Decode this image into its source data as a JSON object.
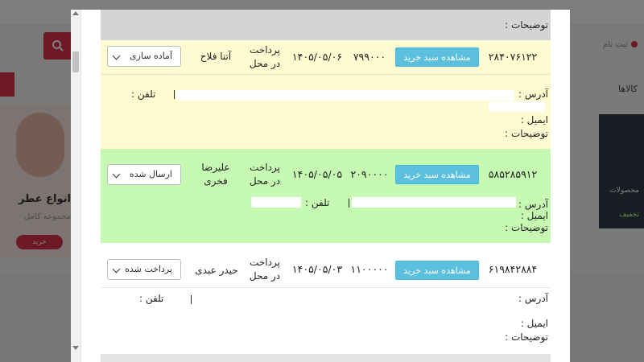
{
  "background": {
    "bg_promo_title": "انواع عطر",
    "bg_promo_sub": "مجموعه کامل",
    "bg_promo_btn": "خرید",
    "bg_user": "ثبت نام",
    "bg_category": "کالاها",
    "bg_card_1": "محصولات",
    "bg_card_2": "تخفیف"
  },
  "modal": {
    "top_notes_label": "توضیحات :",
    "orders": [
      {
        "code": "۲۸۴۰۷۶۱۲۲",
        "basket_label": "مشاهده سبد خرید",
        "amount": "۷۹۹۰۰۰",
        "date": "۱۴۰۵/۰۵/۰۶",
        "payment_line1": "پرداخت",
        "payment_line2": "در محل",
        "customer_line1": "آتنا فلاح",
        "customer_line2": "",
        "status": "آماده سازی",
        "address_label": "آدرس :",
        "phone_label": "تلفن :",
        "email_label": "ایمیل :",
        "notes_label": "توضیحات :"
      },
      {
        "code": "۵۸۵۲۸۵۹۱۲",
        "basket_label": "مشاهده سبد خرید",
        "amount": "۲۰۹۰۰۰۰",
        "date": "۱۴۰۵/۰۵/۰۵",
        "payment_line1": "پرداخت",
        "payment_line2": "در محل",
        "customer_line1": "علیرضا",
        "customer_line2": "فخری",
        "status": "ارسال شده",
        "address_label": "آدرس :",
        "phone_label": "تلفن :",
        "email_label": "ایمیل :",
        "notes_label": "توضیحات :"
      },
      {
        "code": "۶۱۹۸۴۲۸۸۴",
        "basket_label": "مشاهده سبد خرید",
        "amount": "۱۱۰۰۰۰۰",
        "date": "۱۴۰۵/۰۵/۰۳",
        "payment_line1": "پرداخت",
        "payment_line2": "در محل",
        "customer_line1": "حیدر عبدی",
        "customer_line2": "",
        "status": "پرداخت شده",
        "address_label": "آدرس :",
        "phone_label": "تلفن :",
        "email_label": "ایمیل :",
        "notes_label": "توضیحات :"
      }
    ]
  },
  "colors": {
    "row_pending": "#fffbd1",
    "row_sent": "#c6f9b2",
    "row_paid": "#ffffff",
    "button_info": "#5bc0de",
    "accent": "#d9304a"
  }
}
